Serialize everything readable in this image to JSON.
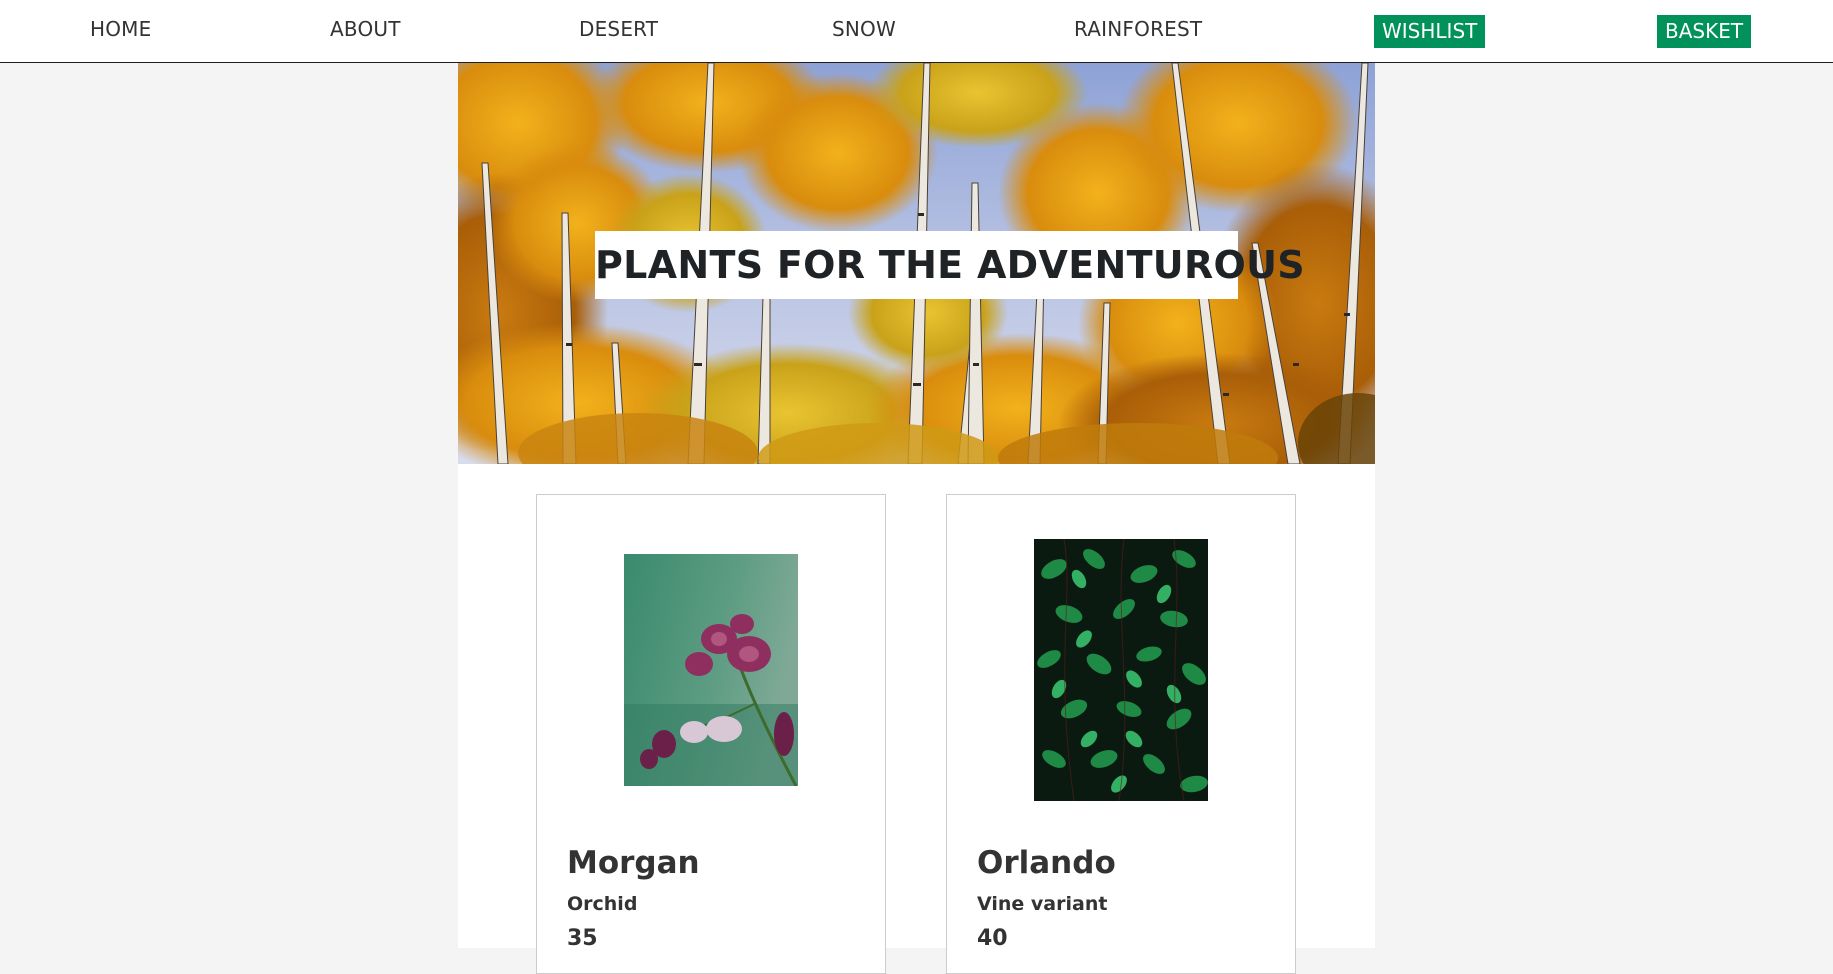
{
  "nav": {
    "links": [
      "HOME",
      "ABOUT",
      "DESERT",
      "SNOW",
      "RAINFOREST"
    ],
    "wishlist_label": "WISHLIST",
    "basket_label": "BASKET",
    "accent_color": "#00925a"
  },
  "hero": {
    "title": "PLANTS FOR THE ADVENTUROUS"
  },
  "products": [
    {
      "name": "Morgan",
      "type": "Orchid",
      "price": "35"
    },
    {
      "name": "Orlando",
      "type": "Vine variant",
      "price": "40"
    }
  ]
}
